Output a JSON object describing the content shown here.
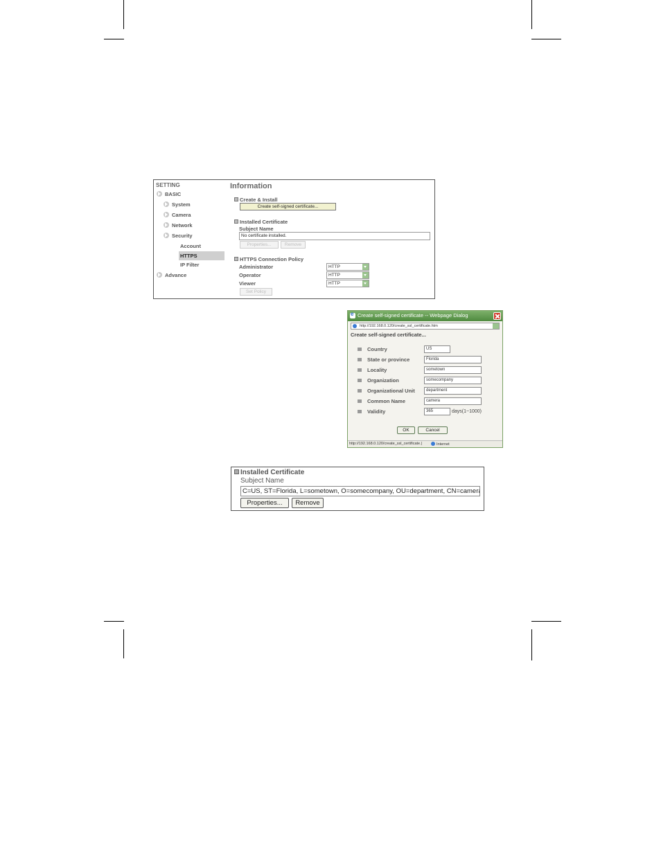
{
  "settings_page": {
    "sidebar": {
      "heading": "SETTING",
      "items": [
        {
          "label": "BASIC"
        },
        {
          "label": "System"
        },
        {
          "label": "Camera"
        },
        {
          "label": "Network"
        },
        {
          "label": "Security"
        },
        {
          "label": "Account"
        },
        {
          "label": "HTTPS",
          "active": true
        },
        {
          "label": "IP Filter"
        },
        {
          "label": "Advance"
        }
      ]
    },
    "title": "Information",
    "create_install": {
      "heading": "Create & Install",
      "create_button": "Create self-signed certificate..."
    },
    "installed_certificate": {
      "heading": "Installed Certificate",
      "subject_label": "Subject Name",
      "subject_value": "No certificate installed.",
      "properties_button": "Properties...",
      "remove_button": "Remove"
    },
    "connection_policy": {
      "heading": "HTTPS Connection Policy",
      "rows": [
        {
          "label": "Administrator",
          "value": "HTTP"
        },
        {
          "label": "Operator",
          "value": "HTTP"
        },
        {
          "label": "Viewer",
          "value": "HTTP"
        }
      ],
      "set_policy_button": "Set Policy"
    }
  },
  "dialog": {
    "title": "Create self-signed certificate -- Webpage Dialog",
    "address": "http://192.168.0.120/create_ssl_certificate.htm",
    "heading": "Create self-signed certificate...",
    "fields": [
      {
        "label": "Country",
        "value": "US"
      },
      {
        "label": "State or province",
        "value": "Florida"
      },
      {
        "label": "Locality",
        "value": "sometown"
      },
      {
        "label": "Organization",
        "value": "somecompany"
      },
      {
        "label": "Organizational Unit",
        "value": "department"
      },
      {
        "label": "Common Name",
        "value": "camera"
      },
      {
        "label": "Validity",
        "value": "365",
        "unit": "days(1~1000)"
      }
    ],
    "ok_button": "OK",
    "cancel_button": "Cancel",
    "status_url": "http://192.168.0.120/create_ssl_certificate.|",
    "status_zone": "Internet"
  },
  "result_panel": {
    "heading": "Installed Certificate",
    "subject_label": "Subject Name",
    "subject_value": "C=US, ST=Florida, L=sometown, O=somecompany, OU=department, CN=camera",
    "properties_button": "Properties...",
    "remove_button": "Remove"
  }
}
